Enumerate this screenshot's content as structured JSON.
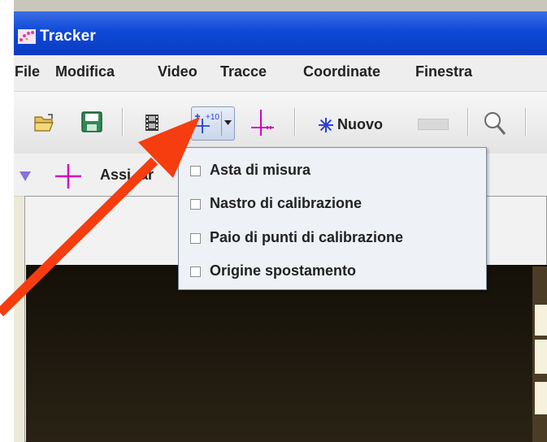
{
  "window": {
    "title": "Tracker"
  },
  "menubar": {
    "items": [
      "File",
      "Modifica",
      "Video",
      "Tracce",
      "Coordinate",
      "Finestra"
    ]
  },
  "toolbar": {
    "open_icon": "folder-open-icon",
    "save_icon": "save-icon",
    "video_icon": "film-icon",
    "calibration_button_text": "+10",
    "axes_icon": "axes-icon",
    "new_track_label": "Nuovo",
    "zoom_icon": "magnifier-icon"
  },
  "second_bar": {
    "axes_label": "Assi",
    "axes_label_tail": "ar"
  },
  "calibration_menu": {
    "items": [
      {
        "label": "Asta di misura",
        "checked": false
      },
      {
        "label": "Nastro di calibrazione",
        "checked": false
      },
      {
        "label": "Paio di punti di calibrazione",
        "checked": false
      },
      {
        "label": "Origine spostamento",
        "checked": false
      }
    ]
  },
  "colors": {
    "title_bar": "#0e49d8",
    "annotation_arrow": "#f53d0f",
    "axes_magenta": "#d400c8",
    "new_track_star": "#2b3fd6"
  }
}
